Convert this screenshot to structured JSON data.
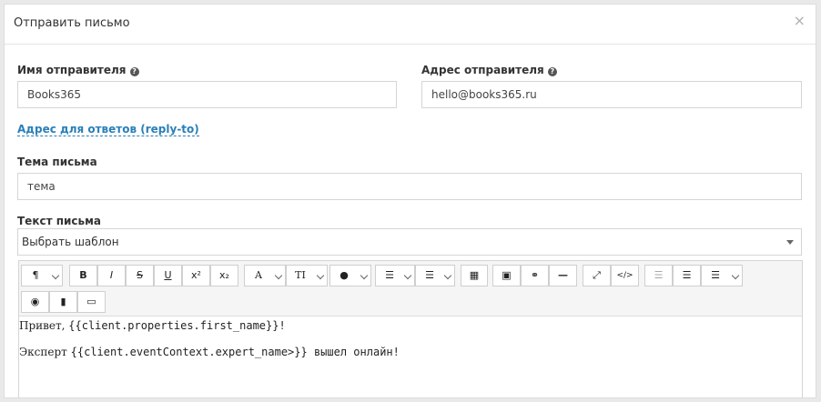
{
  "modal": {
    "title": "Отправить письмо",
    "close": "×"
  },
  "sender": {
    "name_label": "Имя отправителя",
    "name_value": "Books365",
    "address_label": "Адрес отправителя",
    "address_value": "hello@books365.ru",
    "help_glyph": "?"
  },
  "reply_to_link": "Адрес для ответов (reply-to)",
  "subject": {
    "label": "Тема письма",
    "value": "тема"
  },
  "body": {
    "label": "Текст письма",
    "template_select": "Выбрать шаблон",
    "line1_prefix": "Привет, ",
    "line1_code": "{{client.properties.first_name}}!",
    "line2_prefix": "Эксперт ",
    "line2_code": "{{client.eventContext.expert_name>}} вышел онлайн!"
  },
  "toolbar": {
    "paragraph": "¶",
    "bold": "B",
    "italic": "I",
    "strike": "S",
    "underline": "U",
    "superscript": "x²",
    "subscript": "x₂",
    "font_color": "A",
    "font_size": "TI",
    "drop": "●",
    "bullet_list": "☰",
    "numbered_list": "☰",
    "table": "▦",
    "image": "▣",
    "link": "⚭",
    "hr": "—",
    "fullscreen": "⤢",
    "code": "</>",
    "outdent": "☰",
    "indent": "☰",
    "align": "☰",
    "preview": "◉",
    "bookmark": "▮",
    "desktop": "▭"
  }
}
